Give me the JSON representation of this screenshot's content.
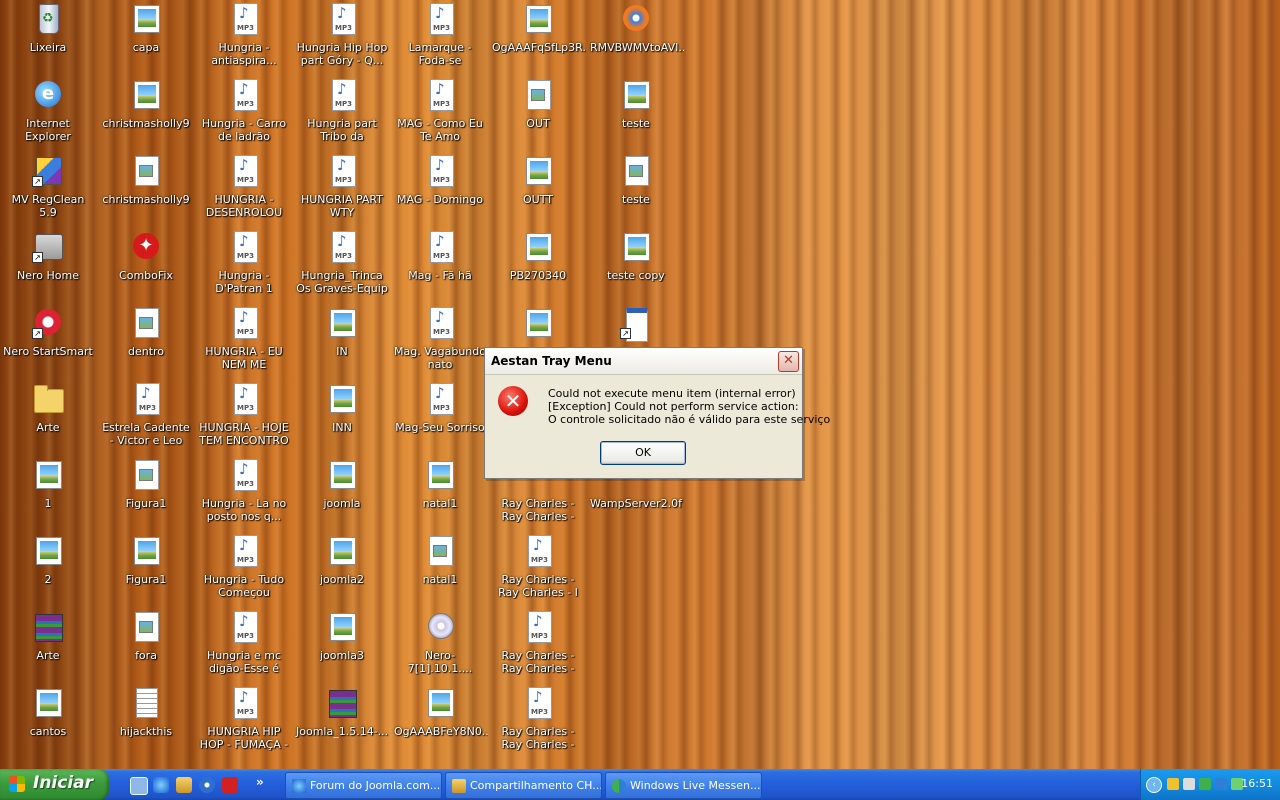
{
  "desktop": {
    "icons": [
      {
        "label": "Lixeira",
        "icon": "recycle-bin-icon",
        "type": "trash"
      },
      {
        "label": "Internet Explorer",
        "icon": "internet-explorer-icon",
        "type": "ie"
      },
      {
        "label": "MV RegClean 5.9",
        "icon": "regclean-icon",
        "type": "reg"
      },
      {
        "label": "Nero Home",
        "icon": "nero-home-icon",
        "type": "nero"
      },
      {
        "label": "Nero StartSmart",
        "icon": "nero-startsmart-icon",
        "type": "nerored"
      },
      {
        "label": "Arte",
        "icon": "folder-icon",
        "type": "folder"
      },
      {
        "label": "1",
        "icon": "image-file-icon",
        "type": "img"
      },
      {
        "label": "2",
        "icon": "image-file-icon",
        "type": "img"
      },
      {
        "label": "Arte",
        "icon": "rar-archive-icon",
        "type": "rar"
      },
      {
        "label": "cantos",
        "icon": "image-file-icon",
        "type": "img"
      },
      {
        "label": "capa",
        "icon": "image-file-icon",
        "type": "img"
      },
      {
        "label": "christmasholly9",
        "icon": "image-file-icon",
        "type": "img"
      },
      {
        "label": "christmasholly9",
        "icon": "picture-document-icon",
        "type": "doc"
      },
      {
        "label": "ComboFix",
        "icon": "combofix-icon",
        "type": "combo"
      },
      {
        "label": "dentro",
        "icon": "picture-document-icon",
        "type": "doc"
      },
      {
        "label": "Estrela Cadente - Victor e Leo",
        "icon": "mp3-file-icon",
        "type": "mp3"
      },
      {
        "label": "Figura1",
        "icon": "document-icon",
        "type": "doc"
      },
      {
        "label": "Figura1",
        "icon": "image-file-icon",
        "type": "img"
      },
      {
        "label": "fora",
        "icon": "picture-document-icon",
        "type": "doc"
      },
      {
        "label": "hijackthis",
        "icon": "text-file-icon",
        "type": "txt"
      },
      {
        "label": "Hungria - antiaspira...",
        "icon": "mp3-file-icon",
        "type": "mp3"
      },
      {
        "label": "Hungria - Carro de ladrão",
        "icon": "mp3-file-icon",
        "type": "mp3"
      },
      {
        "label": "HUNGRIA - DESENROLOU",
        "icon": "mp3-file-icon",
        "type": "mp3"
      },
      {
        "label": "Hungria - D'Patran 1",
        "icon": "mp3-file-icon",
        "type": "mp3"
      },
      {
        "label": "HUNGRIA - EU NEM ME ESTRESSO",
        "icon": "mp3-file-icon",
        "type": "mp3"
      },
      {
        "label": "HUNGRIA - HOJE TEM ENCONTRO",
        "icon": "mp3-file-icon",
        "type": "mp3"
      },
      {
        "label": "Hungria - La no posto nos q...",
        "icon": "mp3-file-icon",
        "type": "mp3"
      },
      {
        "label": "Hungria - Tudo Começou",
        "icon": "mp3-file-icon",
        "type": "mp3"
      },
      {
        "label": "Hungria e mc digão-Esse é m...",
        "icon": "mp3-file-icon",
        "type": "mp3"
      },
      {
        "label": "HUNGRIA HIP HOP - FUMAÇA - NO...",
        "icon": "mp3-file-icon",
        "type": "mp3"
      },
      {
        "label": "Hungria Hip Hop part Góry - Q...",
        "icon": "mp3-file-icon",
        "type": "mp3"
      },
      {
        "label": "Hungria part Tribo da periferia - Q...",
        "icon": "mp3-file-icon",
        "type": "mp3"
      },
      {
        "label": "HUNGRIA PART WTY MOLEQUE...",
        "icon": "mp3-file-icon",
        "type": "mp3"
      },
      {
        "label": "Hungria_Trinca Os Graves-Equip bic...",
        "icon": "mp3-file-icon",
        "type": "mp3"
      },
      {
        "label": "IN",
        "icon": "image-file-icon",
        "type": "img"
      },
      {
        "label": "INN",
        "icon": "image-file-icon",
        "type": "img"
      },
      {
        "label": "joomla",
        "icon": "image-file-icon",
        "type": "img"
      },
      {
        "label": "joomla2",
        "icon": "image-file-icon",
        "type": "img"
      },
      {
        "label": "joomla3",
        "icon": "image-file-icon",
        "type": "img"
      },
      {
        "label": "Joomla_1.5.14-...",
        "icon": "rar-archive-icon",
        "type": "rar"
      },
      {
        "label": "Lamarque - Foda-se HUNGRIA",
        "icon": "mp3-file-icon",
        "type": "mp3"
      },
      {
        "label": "MAG - Como Eu Te Amo",
        "icon": "mp3-file-icon",
        "type": "mp3"
      },
      {
        "label": "MAG - Domingo",
        "icon": "mp3-file-icon",
        "type": "mp3"
      },
      {
        "label": "Mag - Fã hã",
        "icon": "mp3-file-icon",
        "type": "mp3"
      },
      {
        "label": "Mag. Vagabundo nato",
        "icon": "mp3-file-icon",
        "type": "mp3"
      },
      {
        "label": "Mag-Seu Sorriso",
        "icon": "mp3-file-icon",
        "type": "mp3"
      },
      {
        "label": "natal1",
        "icon": "image-file-icon",
        "type": "img"
      },
      {
        "label": "natal1",
        "icon": "picture-document-icon",
        "type": "doc"
      },
      {
        "label": "Nero-7[1].10.1....",
        "icon": "nero-installer-icon",
        "type": "cd"
      },
      {
        "label": "OgAAABFeY8N0...",
        "icon": "image-file-icon",
        "type": "img"
      },
      {
        "label": "OgAAAFqSfLp3R...",
        "icon": "image-file-icon",
        "type": "img"
      },
      {
        "label": "OUT",
        "icon": "picture-document-icon",
        "type": "doc"
      },
      {
        "label": "OUTT",
        "icon": "image-file-icon",
        "type": "img"
      },
      {
        "label": "PB270340",
        "icon": "image-file-icon",
        "type": "img"
      },
      {
        "label": "",
        "icon": "image-file-icon",
        "type": "img"
      },
      {
        "label": "",
        "icon": "mp3-file-icon",
        "type": "none"
      },
      {
        "label": "Ray Charles - Ray Charles - Hit Th...",
        "icon": "mp3-file-icon",
        "type": "none"
      },
      {
        "label": "Ray Charles - Ray Charles - I Can ...",
        "icon": "mp3-file-icon",
        "type": "mp3"
      },
      {
        "label": "Ray Charles - Ray Charles - Mess ...",
        "icon": "mp3-file-icon",
        "type": "mp3"
      },
      {
        "label": "Ray Charles - Ray Charles - What'...",
        "icon": "mp3-file-icon",
        "type": "mp3"
      },
      {
        "label": "RMVBWMVtoAVI...",
        "icon": "converter-icon",
        "type": "conv"
      },
      {
        "label": "teste",
        "icon": "image-file-icon",
        "type": "img"
      },
      {
        "label": "teste",
        "icon": "picture-document-icon",
        "type": "doc"
      },
      {
        "label": "teste copy",
        "icon": "image-file-icon",
        "type": "img"
      },
      {
        "label": "",
        "icon": "application-shortcut-icon",
        "type": "app"
      },
      {
        "label": "",
        "icon": "blank",
        "type": "none"
      },
      {
        "label": "WampServer2.0f",
        "icon": "wampserver-icon",
        "type": "wamp"
      }
    ]
  },
  "dialog": {
    "title": "Aestan Tray Menu",
    "close_symbol": "✕",
    "error_symbol": "✕",
    "message_lines": [
      "Could not execute menu item (internal error)",
      "[Exception] Could not perform service action:",
      "O controle solicitado não é válido para este serviço"
    ],
    "ok_label": "OK"
  },
  "taskbar": {
    "start_label": "Iniciar",
    "more_symbol": "»",
    "tasks": [
      {
        "label": "Forum do Joomla.com...",
        "icon": "ie-window-icon"
      },
      {
        "label": "Compartilhamento CH...",
        "icon": "folder-window-icon"
      },
      {
        "label": "Windows Live Messen...",
        "icon": "messenger-icon"
      }
    ],
    "tray": {
      "expand_symbol": "‹",
      "clock": "16:51"
    }
  }
}
